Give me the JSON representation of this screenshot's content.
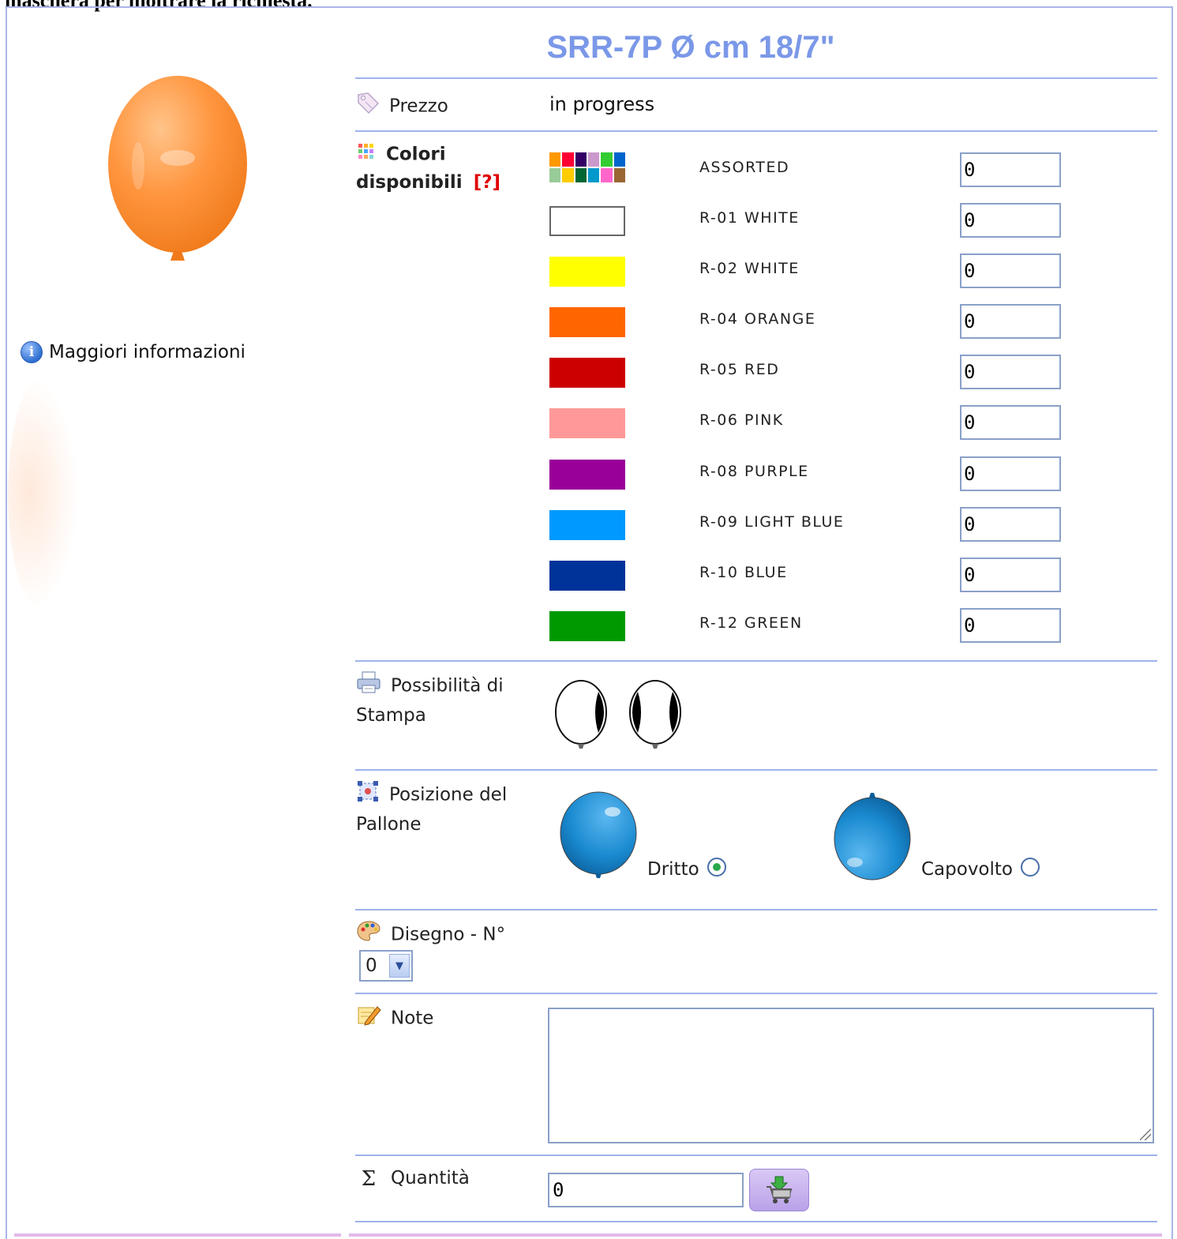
{
  "caption": "maschera per inoltrare la richiesta.",
  "product": {
    "title": "SRR-7P Ø cm 18/7\"",
    "more_info": "Maggiori informazioni"
  },
  "price": {
    "label": "Prezzo",
    "value": "in progress"
  },
  "colors": {
    "label_line1": "Colori",
    "label_line2": "disponibili",
    "help": "[?]",
    "items": [
      {
        "name": "ASSORTED",
        "swatch": "assorted",
        "qty": "0"
      },
      {
        "name": "R-01 WHITE",
        "swatch": "#ffffff",
        "qty": "0"
      },
      {
        "name": "R-02 WHITE",
        "swatch": "#ffff00",
        "qty": "0"
      },
      {
        "name": "R-04 ORANGE",
        "swatch": "#ff6600",
        "qty": "0"
      },
      {
        "name": "R-05 RED",
        "swatch": "#cc0000",
        "qty": "0"
      },
      {
        "name": "R-06 PINK",
        "swatch": "#ff9999",
        "qty": "0"
      },
      {
        "name": "R-08 PURPLE",
        "swatch": "#990099",
        "qty": "0"
      },
      {
        "name": "R-09 LIGHT BLUE",
        "swatch": "#0099ff",
        "qty": "0"
      },
      {
        "name": "R-10 BLUE",
        "swatch": "#003399",
        "qty": "0"
      },
      {
        "name": "R-12 GREEN",
        "swatch": "#009900",
        "qty": "0"
      }
    ],
    "assorted_palette": [
      "#ff9900",
      "#ff0033",
      "#330066",
      "#cc99cc",
      "#33cc33",
      "#0066cc",
      "#99cc99",
      "#ffcc00",
      "#006633",
      "#0099cc",
      "#ff66cc",
      "#996633"
    ]
  },
  "print": {
    "label_line1": "Possibilità di",
    "label_line2": "Stampa"
  },
  "position": {
    "label_line1": "Posizione del",
    "label_line2": "Pallone",
    "options": [
      {
        "label": "Dritto",
        "checked": true
      },
      {
        "label": "Capovolto",
        "checked": false
      }
    ],
    "balloon_color": "#1a8ad0"
  },
  "design": {
    "label": "Disegno - N°",
    "selected": "0"
  },
  "note": {
    "label": "Note",
    "value": ""
  },
  "quantity": {
    "label": "Quantità",
    "value": "0"
  },
  "theme": {
    "accent": "#7b98e8",
    "rule": "#9fb3ea",
    "product_balloon": "#ff8a2a"
  }
}
